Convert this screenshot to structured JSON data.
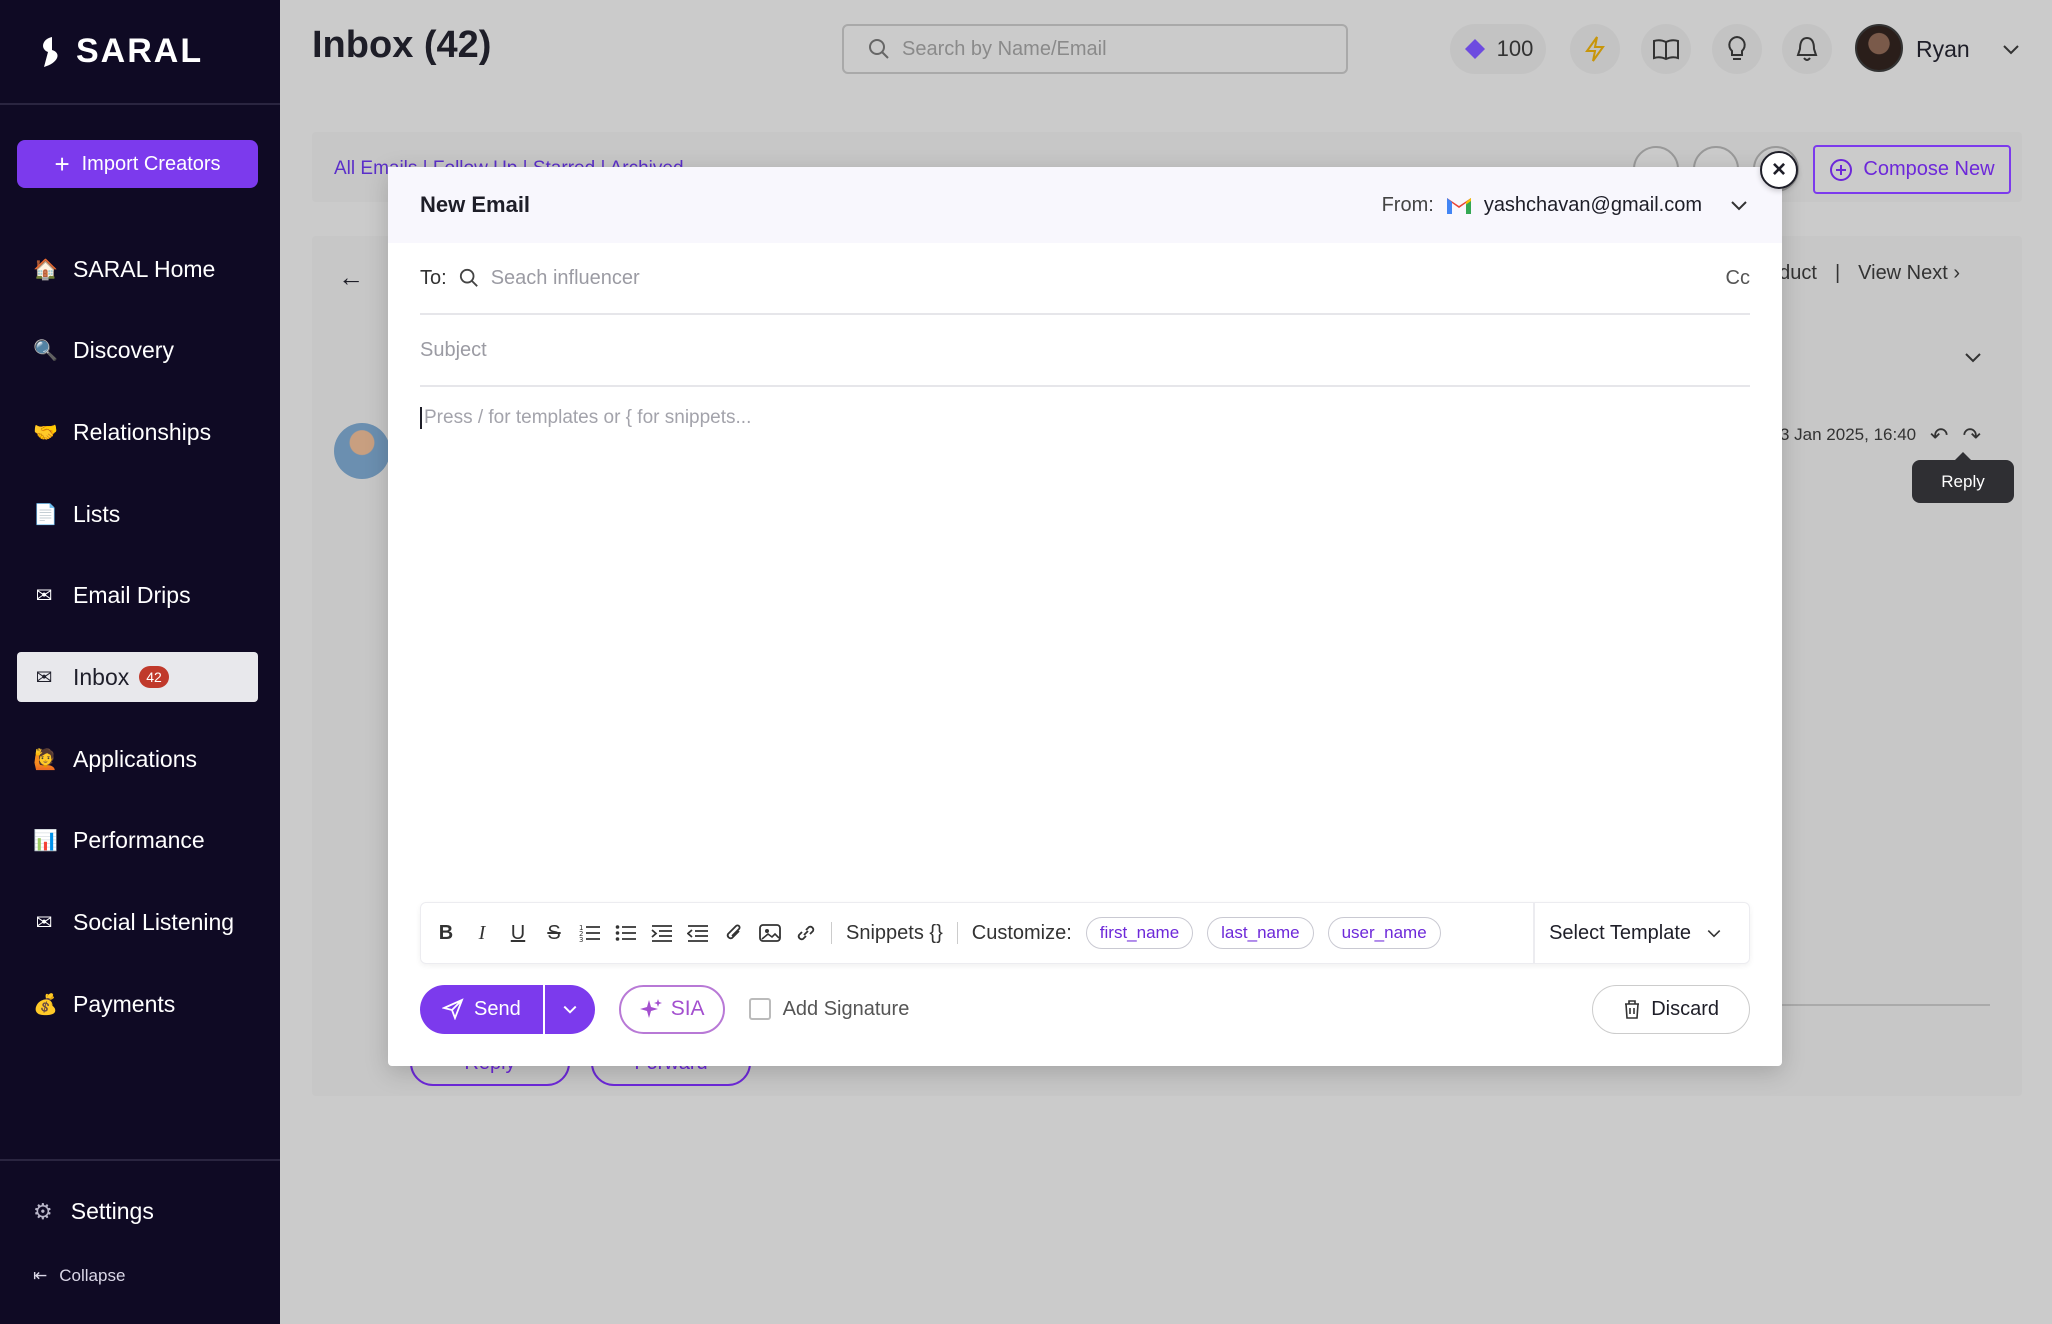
{
  "app": {
    "brand": "SARAL"
  },
  "sidebar": {
    "import_label": "Import Creators",
    "items": [
      {
        "label": "SARAL Home",
        "icon": "home-icon",
        "glyph": "🏠"
      },
      {
        "label": "Discovery",
        "icon": "magnifier-icon",
        "glyph": "🔍"
      },
      {
        "label": "Relationships",
        "icon": "handshake-icon",
        "glyph": "🤝"
      },
      {
        "label": "Lists",
        "icon": "document-icon",
        "glyph": "📄"
      },
      {
        "label": "Email Drips",
        "icon": "envelope-icon",
        "glyph": "✉"
      },
      {
        "label": "Inbox",
        "icon": "envelope-icon",
        "glyph": "✉",
        "badge": "42"
      },
      {
        "label": "Applications",
        "icon": "person-icon",
        "glyph": "🙋"
      },
      {
        "label": "Performance",
        "icon": "bar-chart-icon",
        "glyph": "📊"
      },
      {
        "label": "Social Listening",
        "icon": "envelope-icon",
        "glyph": "✉"
      },
      {
        "label": "Payments",
        "icon": "money-bag-icon",
        "glyph": "💰"
      }
    ],
    "settings_label": "Settings",
    "collapse_label": "Collapse"
  },
  "topbar": {
    "title": "Inbox (42)",
    "search_placeholder": "Search by Name/Email",
    "credits": "100",
    "user_name": "Ryan"
  },
  "background": {
    "filter_text": "All Emails   |   Follow Up   |   Starred   |   Archived",
    "compose_new": "Compose New",
    "product_fragment": "oduct",
    "view_next": "View Next",
    "message_date": "3 Jan 2025, 16:40",
    "reply_tooltip": "Reply",
    "reply_btn": "Reply",
    "forward_btn": "Forward"
  },
  "compose": {
    "title": "New Email",
    "from_label": "From:",
    "from_email": "yashchavan@gmail.com",
    "to_label": "To:",
    "to_placeholder": "Seach influencer",
    "cc_label": "Cc",
    "subject_placeholder": "Subject",
    "body_placeholder": "Press / for templates or { for snippets...",
    "toolbar": {
      "snippets": "Snippets {}",
      "customize": "Customize:",
      "chips": [
        "first_name",
        "last_name",
        "user_name"
      ],
      "select_template": "Select Template"
    },
    "send": "Send",
    "sia": "SIA",
    "add_signature": "Add Signature",
    "discard": "Discard"
  },
  "colors": {
    "accent": "#7c3aed",
    "sidebar_bg": "#0f0a24",
    "badge": "#c0392b"
  }
}
